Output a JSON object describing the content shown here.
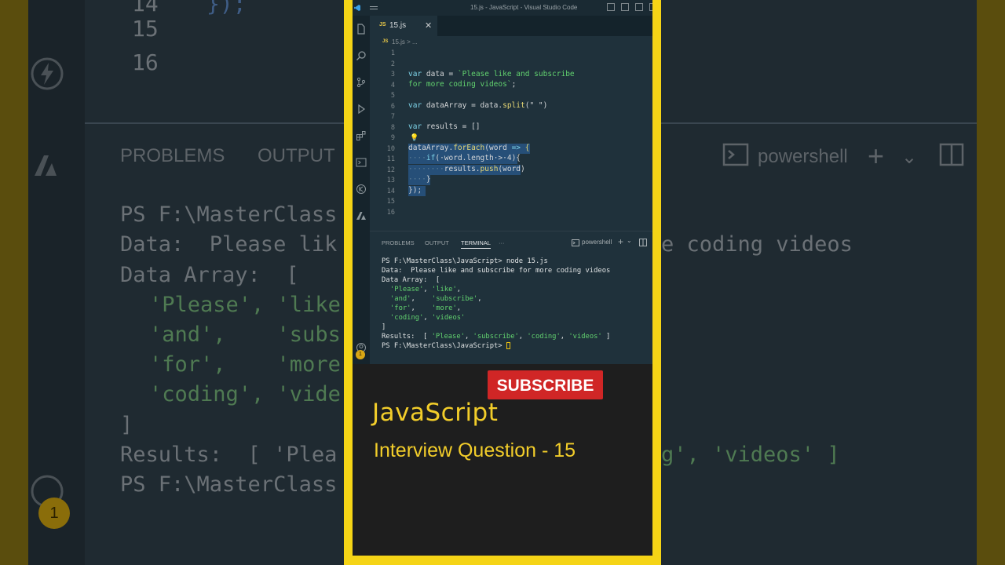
{
  "window": {
    "title": "15.js - JavaScript - Visual Studio Code"
  },
  "tab": {
    "lang_badge": "JS",
    "filename": "15.js",
    "close_glyph": "✕"
  },
  "breadcrumb": {
    "lang_badge": "JS",
    "path": "15.js > ..."
  },
  "editor": {
    "line_numbers": [
      "1",
      "2",
      "3",
      "4",
      "5",
      "6",
      "7",
      "8",
      "9",
      "10",
      "11",
      "12",
      "13",
      "14",
      "15",
      "16"
    ],
    "lines": {
      "l3": {
        "kw": "var ",
        "name": "data = ",
        "str": "`Please like and subscribe"
      },
      "l4": {
        "str": "for more coding videos`",
        "end": ";"
      },
      "l6": {
        "kw": "var ",
        "name": "dataArray = data.",
        "fn": "split",
        "args": "(\" \")"
      },
      "l8": {
        "kw": "var ",
        "name": "results = []"
      },
      "l10": {
        "name": "dataArray.",
        "fn": "forEach",
        "args": "(word",
        "kw": " => ",
        "end": "{"
      },
      "l11": {
        "ind": "····",
        "kw": "if",
        "args": "(·word.length·>·4){"
      },
      "l12": {
        "ind": "········",
        "name": "results.",
        "fn": "push",
        "args": "(word)"
      },
      "l13": {
        "ind": "····",
        "end": "}"
      },
      "l14": {
        "end": "});"
      }
    }
  },
  "panel": {
    "tabs": [
      "PROBLEMS",
      "OUTPUT",
      "TERMINAL"
    ],
    "more": "···",
    "shell": "powershell",
    "plus": "+",
    "terminal": {
      "cmd": "PS F:\\MasterClass\\JavaScript> node 15.js",
      "data_line": "Data:  Please like and subscribe for more coding videos",
      "array_open": "Data Array:  [",
      "row1a": "'Please'",
      "row1b": "'like'",
      "row2a": "'and'",
      "row2b": "'subscribe'",
      "row3a": "'for'",
      "row3b": "'more'",
      "row4a": "'coding'",
      "row4b": "'videos'",
      "array_close": "]",
      "results_label": "Results:  [ ",
      "res1": "'Please'",
      "res2": "'subscribe'",
      "res3": "'coding'",
      "res4": "'videos'",
      "results_end": " ]",
      "prompt": "PS F:\\MasterClass\\JavaScript> "
    },
    "badge_count": "1"
  },
  "backdrop": {
    "ln14": "14",
    "ln15": "15",
    "ln16": "16",
    "code14": "});",
    "tab_problems": "PROBLEMS",
    "tab_output": "OUTPUT",
    "shell": "powershell",
    "t1": "PS F:\\MasterClass",
    "t2": "Data:  Please lik",
    "t3": "Data Array:  [",
    "t4a": "'Please', 'like",
    "t5a": "'and',    'subs",
    "t6a": "'for',    'more",
    "t7a": "'coding', 'vide",
    "t8": "]",
    "t9a": "Results:  [ 'Plea",
    "t10": "PS F:\\MasterClass",
    "r2": "e coding videos",
    "r9": "g', 'videos' ]",
    "badge": "1"
  },
  "promo": {
    "subscribe": "SUBSCRIBE",
    "title": "JavaScript",
    "subtitle": "Interview Question - 15"
  },
  "colors": {
    "frame": "#f5d416",
    "accent_text": "#f2cd2a",
    "subscribe_bg": "#d02626",
    "selection": "#264f78",
    "string": "#62d26f"
  }
}
